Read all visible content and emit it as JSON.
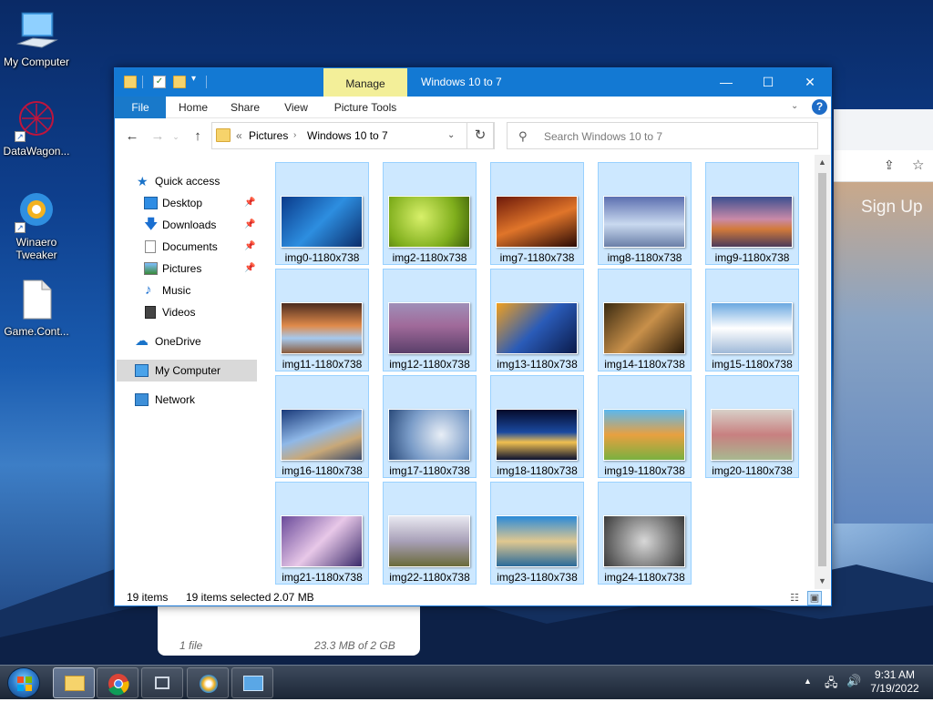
{
  "desktop": {
    "icons": [
      {
        "label": "My Computer",
        "icon": "monitor-icon"
      },
      {
        "label": "DataWagon...",
        "icon": "datawagon-icon"
      },
      {
        "label": "Winaero\nTweaker",
        "icon": "winaero-tweaker-icon"
      },
      {
        "label": "Game.Cont...",
        "icon": "file-icon"
      }
    ],
    "background_browser": {
      "signup_label": "Sign Up"
    },
    "storage_card": {
      "files": "1 file",
      "usage": "23.3 MB of 2 GB"
    }
  },
  "window": {
    "title": "Windows 10 to 7",
    "context_tab_group": "Manage",
    "controls": {
      "minimize": "—",
      "maximize": "☐",
      "close": "✕"
    },
    "ribbon_tabs": [
      "File",
      "Home",
      "Share",
      "View",
      "Picture Tools"
    ],
    "address": {
      "prefix": "«",
      "segments": [
        "Pictures",
        "Windows 10 to 7"
      ]
    },
    "search_placeholder": "Search Windows 10 to 7",
    "nav_pane": {
      "quick_access": "Quick access",
      "items": [
        {
          "label": "Desktop",
          "pinned": true
        },
        {
          "label": "Downloads",
          "pinned": true
        },
        {
          "label": "Documents",
          "pinned": true
        },
        {
          "label": "Pictures",
          "pinned": true
        },
        {
          "label": "Music",
          "pinned": false
        },
        {
          "label": "Videos",
          "pinned": false
        }
      ],
      "onedrive": "OneDrive",
      "my_computer": "My Computer",
      "network": "Network"
    },
    "files": [
      "img0-1180x738",
      "img2-1180x738",
      "img7-1180x738",
      "img8-1180x738",
      "img9-1180x738",
      "img11-1180x738",
      "img12-1180x738",
      "img13-1180x738",
      "img14-1180x738",
      "img15-1180x738",
      "img16-1180x738",
      "img17-1180x738",
      "img18-1180x738",
      "img19-1180x738",
      "img20-1180x738",
      "img21-1180x738",
      "img22-1180x738",
      "img23-1180x738",
      "img24-1180x738"
    ],
    "status": {
      "count": "19 items",
      "selected": "19 items selected",
      "size": "2.07 MB"
    }
  },
  "taskbar": {
    "time": "9:31 AM",
    "date": "7/19/2022",
    "buttons": [
      "file-explorer",
      "chrome",
      "task-view",
      "winaero-tweaker",
      "control-panel"
    ]
  },
  "colors": {
    "titlebar": "#1379d3",
    "manage_tab": "#f3ef99",
    "selection": "#cde8ff",
    "selection_border": "#99d1ff"
  }
}
